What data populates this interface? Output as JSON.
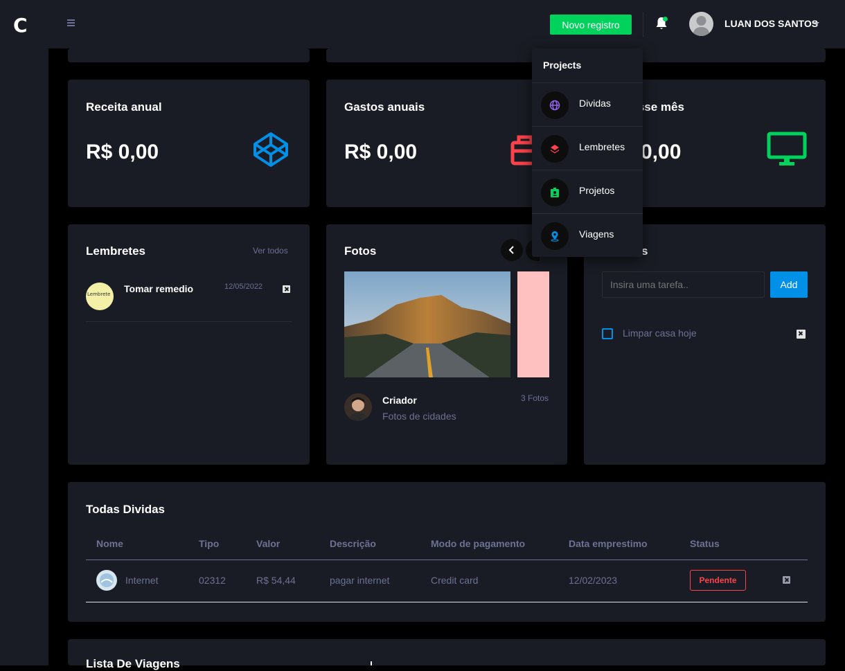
{
  "header": {
    "logo_text": "C",
    "new_button_label": "Novo registro",
    "user_name": "LUAN DOS SANTOS",
    "accent_color": "#00d25b"
  },
  "dropdown": {
    "title": "Projects",
    "items": [
      {
        "label": "Dividas",
        "icon": "globe-icon",
        "color": "#8f5fe8"
      },
      {
        "label": "Lembretes",
        "icon": "layers-icon",
        "color": "#fc424a"
      },
      {
        "label": "Projetos",
        "icon": "contact-card-icon",
        "color": "#00d25b"
      },
      {
        "label": "Viagens",
        "icon": "map-marker-icon",
        "color": "#0090e7"
      }
    ]
  },
  "stats": [
    {
      "title": "Receita anual",
      "value": "R$ 0,00",
      "icon": "codepen-icon",
      "color": "#0090e7"
    },
    {
      "title": "Gastos anuais",
      "value": "R$ 0,00",
      "icon": "briefcase-icon",
      "color": "#fc424a"
    },
    {
      "title": "nesse mês",
      "value": "0,00",
      "icon": "monitor-icon",
      "color": "#00d25b"
    }
  ],
  "reminders": {
    "title": "Lembretes",
    "view_all": "Ver todos",
    "items": [
      {
        "title": "Tomar remedio",
        "date": "12/05/2022",
        "thumb_text": "Lembrete"
      }
    ]
  },
  "photos": {
    "title": "Fotos",
    "creator_name": "Criador",
    "creator_desc": "Fotos de cidades",
    "count": "3 Fotos"
  },
  "tasks": {
    "title_fragment": "s",
    "input_placeholder": "Insira uma tarefa..",
    "add_label": "Add",
    "items": [
      {
        "label": "Limpar casa hoje",
        "checked": false
      }
    ]
  },
  "debts": {
    "title": "Todas Dividas",
    "columns": [
      "Nome",
      "Tipo",
      "Valor",
      "Descrição",
      "Modo de pagamento",
      "Data emprestimo",
      "Status"
    ],
    "rows": [
      {
        "nome": "Internet",
        "tipo": "02312",
        "valor": "R$ 54,44",
        "descricao": "pagar internet",
        "modo": "Credit card",
        "data": "12/02/2023",
        "status": "Pendente"
      }
    ]
  },
  "trips": {
    "title": "Lista De Viagens"
  }
}
